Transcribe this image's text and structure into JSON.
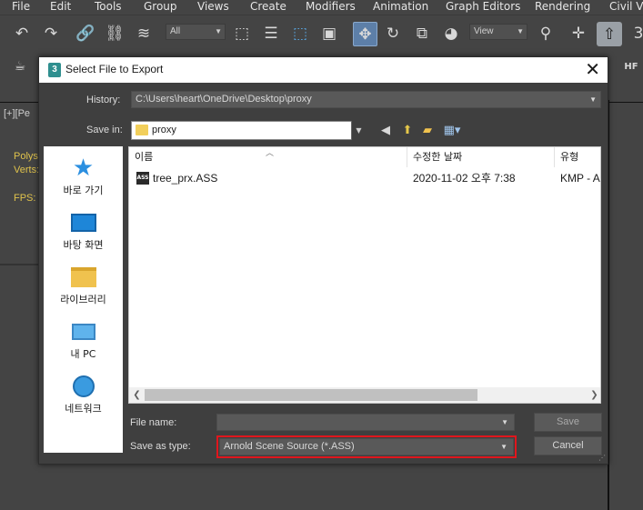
{
  "menu": [
    "File",
    "Edit",
    "Tools",
    "Group",
    "Views",
    "Create",
    "Modifiers",
    "Animation",
    "Graph Editors",
    "Rendering",
    "Civil Vie"
  ],
  "toolbar": {
    "selection_filter": "All",
    "reference_coord": "View"
  },
  "viewport": {
    "label": "[+][Pe",
    "polys": "Polys",
    "verts": "Verts:",
    "fps": "FPS:"
  },
  "dialog": {
    "title": "Select File to Export",
    "history_label": "History:",
    "history_value": "C:\\Users\\heart\\OneDrive\\Desktop\\proxy",
    "savein_label": "Save in:",
    "savein_value": "proxy",
    "places": [
      "바로 가기",
      "바탕 화면",
      "라이브러리",
      "내 PC",
      "네트워크"
    ],
    "columns": [
      "이름",
      "수정한 날짜",
      "유형"
    ],
    "files": [
      {
        "name": "tree_prx.ASS",
        "date": "2020-11-02 오후 7:38",
        "type": "KMP - A"
      }
    ],
    "filename_label": "File name:",
    "filename_value": "",
    "saveas_label": "Save as type:",
    "saveas_value": "Arnold Scene Source (*.ASS)",
    "save_button": "Save",
    "cancel_button": "Cancel"
  },
  "colors": {
    "highlight": "#e0161d",
    "dialog_bg": "#3f3f3f",
    "ui_bg": "#444444"
  }
}
